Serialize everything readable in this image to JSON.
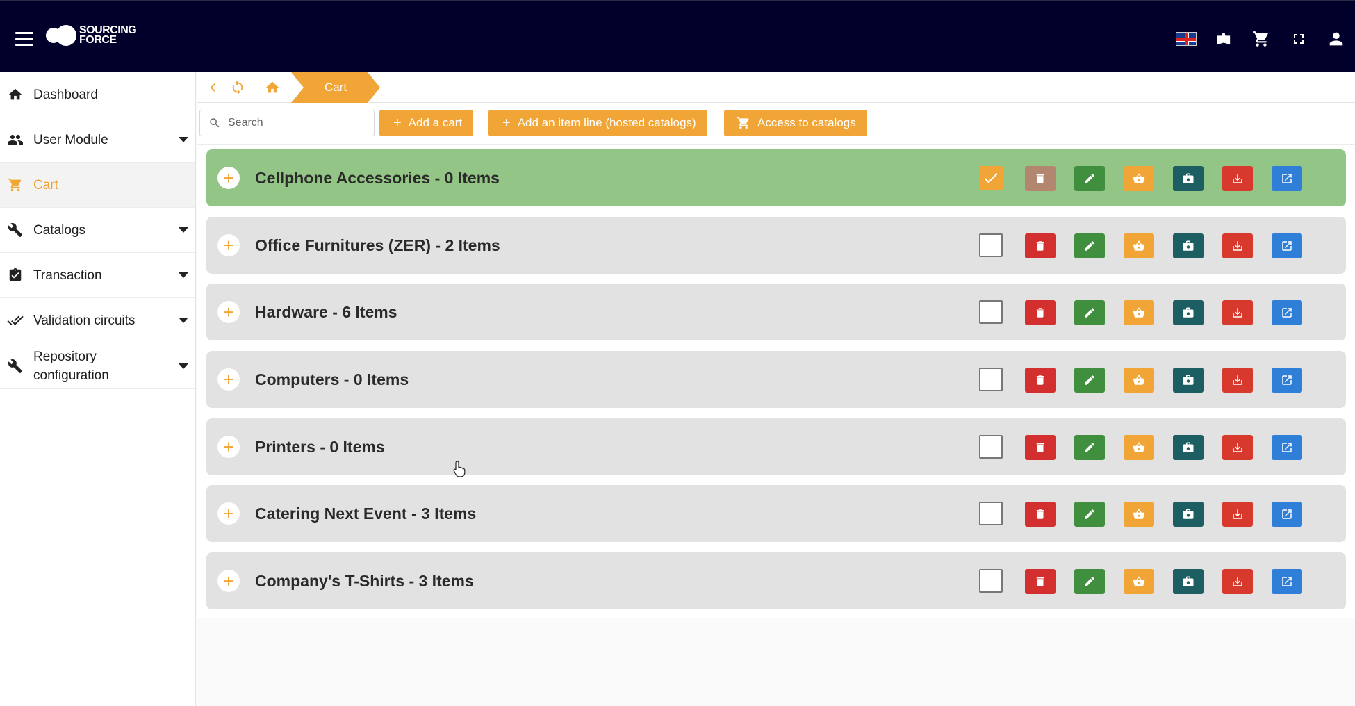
{
  "app": {
    "logo_text_line1": "SOURCING",
    "logo_text_line2": "FORCE"
  },
  "header": {
    "icons": [
      "flag-uk-icon",
      "book-icon",
      "cart-icon",
      "fullscreen-icon",
      "user-icon"
    ]
  },
  "sidebar": {
    "items": [
      {
        "label": "Dashboard",
        "icon": "home-icon",
        "has_caret": false,
        "active": false
      },
      {
        "label": "User Module",
        "icon": "users-icon",
        "has_caret": true,
        "active": false
      },
      {
        "label": "Cart",
        "icon": "cart-icon",
        "has_caret": false,
        "active": true
      },
      {
        "label": "Catalogs",
        "icon": "wrench-icon",
        "has_caret": true,
        "active": false
      },
      {
        "label": "Transaction",
        "icon": "clipboard-icon",
        "has_caret": true,
        "active": false
      },
      {
        "label": "Validation circuits",
        "icon": "double-check-icon",
        "has_caret": true,
        "active": false
      },
      {
        "label": "Repository configuration",
        "icon": "wrench-icon",
        "has_caret": true,
        "active": false
      }
    ]
  },
  "breadcrumb": {
    "current": "Cart"
  },
  "toolbar": {
    "search_placeholder": "Search",
    "add_cart_label": "Add a cart",
    "add_item_line_label": "Add an item line (hosted catalogs)",
    "access_catalogs_label": "Access to catalogs"
  },
  "carts": [
    {
      "title": "Cellphone Accessories - 0 Items",
      "selected": true
    },
    {
      "title": "Office Furnitures (ZER) - 2 Items",
      "selected": false
    },
    {
      "title": "Hardware - 6 Items",
      "selected": false
    },
    {
      "title": "Computers - 0 Items",
      "selected": false
    },
    {
      "title": "Printers - 0 Items",
      "selected": false
    },
    {
      "title": "Catering Next Event - 3 Items",
      "selected": false
    },
    {
      "title": "Company's T-Shirts - 3 Items",
      "selected": false
    }
  ],
  "colors": {
    "topbar": "#00002b",
    "accent": "#f2a537",
    "selected_row": "#93c587",
    "row": "#e2e2e2",
    "delete": "#d32f2f",
    "edit": "#3f8f3f",
    "basket": "#f2a537",
    "briefcase": "#1d5e63",
    "download": "#d8392d",
    "open": "#2f7ed8"
  }
}
